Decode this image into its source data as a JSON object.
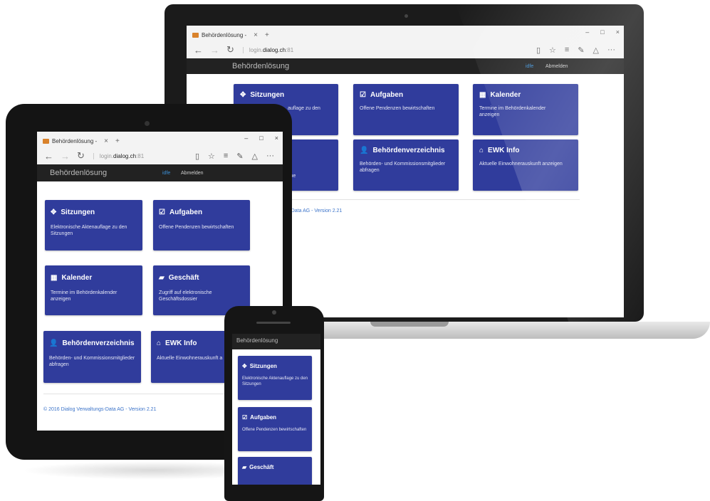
{
  "browser": {
    "tab_title": "Behördenlösung -",
    "tab_close": "×",
    "tab_new": "+",
    "window_minimize": "–",
    "window_maximize": "□",
    "window_close": "×",
    "url_prefix": "login.",
    "url_domain": "dialog.ch",
    "url_suffix": ":81"
  },
  "app": {
    "brand": "Behördenlösung",
    "user": "idfe",
    "logout": "Abmelden",
    "accent_color": "#303c9c",
    "navbar_color": "#222222",
    "link_color": "#3b73c9"
  },
  "tiles": {
    "sitzungen": {
      "title": "Sitzungen",
      "desc": "Elektronische Aktenauflage zu den Sitzungen",
      "icon": "move-icon"
    },
    "aufgaben": {
      "title": "Aufgaben",
      "desc": "Offene Pendenzen bewirtschaften",
      "icon": "check-icon"
    },
    "kalender": {
      "title": "Kalender",
      "desc": "Termine im Behördenkalender anzeigen",
      "icon": "calendar-icon"
    },
    "geschaeft": {
      "title": "Geschäft",
      "desc": "Zugriff auf elektronische Geschäftsdossier",
      "icon": "folder-icon"
    },
    "verzeichnis": {
      "title": "Behördenverzeichnis",
      "desc": "Behörden- und Kommissionsmitglieder abfragen",
      "icon": "user-icon"
    },
    "ewk": {
      "title": "EWK Info",
      "desc": "Aktuelle Einwohnerauskunft anzeigen",
      "icon": "home-icon"
    }
  },
  "laptop": {
    "sitzungen_desc_visible": "auflage zu den",
    "geschaeft_desc_visible": "che",
    "footer_visible": "gs-Data AG - Version 2.21"
  },
  "tablet": {
    "ewk_desc_visible": "Aktuelle Einwohnerauskunft a"
  },
  "footer": "© 2016 Dialog Verwaltungs-Data AG - Version 2.21"
}
